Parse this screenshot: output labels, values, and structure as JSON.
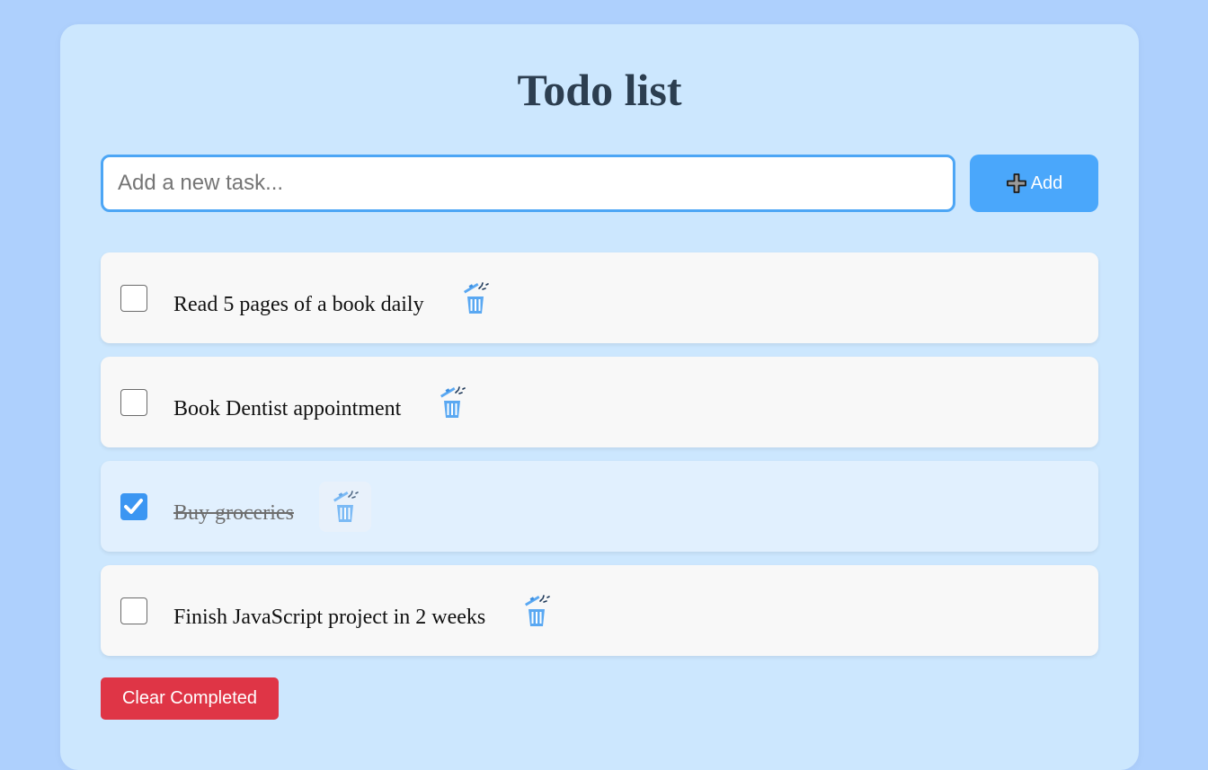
{
  "app": {
    "title": "Todo list"
  },
  "new_task": {
    "placeholder": "Add a new task...",
    "value": "",
    "add_label": "Add"
  },
  "tasks": [
    {
      "text": "Read 5 pages of a book daily",
      "completed": false
    },
    {
      "text": "Book Dentist appointment",
      "completed": false
    },
    {
      "text": "Buy groceries",
      "completed": true
    },
    {
      "text": "Finish JavaScript project in 2 weeks",
      "completed": false
    }
  ],
  "footer": {
    "clear_label": "Clear Completed"
  },
  "icons": {
    "add": "plus-icon",
    "delete": "trash-icon",
    "check": "checkmark-icon"
  },
  "colors": {
    "background": "#aed0fd",
    "card": "#cce7fe",
    "accent": "#4aa7fb",
    "danger": "#df3546",
    "title": "#2c3e50"
  }
}
